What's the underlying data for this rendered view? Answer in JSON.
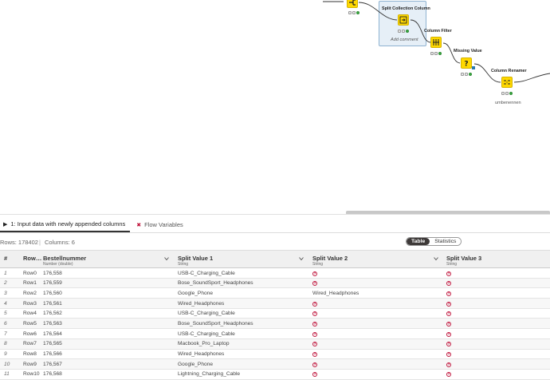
{
  "workflow": {
    "nodes": [
      {
        "id": "top-left-node",
        "title": "",
        "subtitle": ""
      },
      {
        "id": "split-collection-column",
        "title": "Split Collection Column",
        "subtitle": "Add comment"
      },
      {
        "id": "column-filter",
        "title": "Column Filter",
        "subtitle": ""
      },
      {
        "id": "missing-value",
        "title": "Missing Value",
        "subtitle": ""
      },
      {
        "id": "column-renamer",
        "title": "Column Renamer",
        "subtitle": "umbenennen"
      }
    ]
  },
  "tabs": [
    {
      "label": "1: Input data with newly appended columns",
      "icon": "play-icon"
    },
    {
      "label": "Flow Variables",
      "icon": "flow-variable-icon"
    }
  ],
  "info": {
    "rows": "Rows: 178402",
    "separator": "|",
    "columns": "Columns: 6"
  },
  "view_toggle": {
    "table": "Table",
    "statistics": "Statistics"
  },
  "table": {
    "headers": [
      {
        "title": "#",
        "type": ""
      },
      {
        "title": "Row…",
        "type": ""
      },
      {
        "title": "Bestellnummer",
        "type": "Number (double)"
      },
      {
        "title": "Split Value 1",
        "type": "String"
      },
      {
        "title": "Split Value 2",
        "type": "String"
      },
      {
        "title": "Split Value 3",
        "type": "String"
      }
    ],
    "missing_symbol": "?",
    "rows": [
      {
        "n": "1",
        "id": "Row0",
        "num": "176,558",
        "v1": "USB-C_Charging_Cable",
        "v2": null,
        "v3": null
      },
      {
        "n": "2",
        "id": "Row1",
        "num": "176,559",
        "v1": "Bose_SoundSport_Headphones",
        "v2": null,
        "v3": null
      },
      {
        "n": "3",
        "id": "Row2",
        "num": "176,560",
        "v1": "Google_Phone",
        "v2": "Wired_Headphones",
        "v3": null
      },
      {
        "n": "4",
        "id": "Row3",
        "num": "176,561",
        "v1": "Wired_Headphones",
        "v2": null,
        "v3": null
      },
      {
        "n": "5",
        "id": "Row4",
        "num": "176,562",
        "v1": "USB-C_Charging_Cable",
        "v2": null,
        "v3": null
      },
      {
        "n": "6",
        "id": "Row5",
        "num": "176,563",
        "v1": "Bose_SoundSport_Headphones",
        "v2": null,
        "v3": null
      },
      {
        "n": "7",
        "id": "Row6",
        "num": "176,564",
        "v1": "USB-C_Charging_Cable",
        "v2": null,
        "v3": null
      },
      {
        "n": "8",
        "id": "Row7",
        "num": "176,565",
        "v1": "Macbook_Pro_Laptop",
        "v2": null,
        "v3": null
      },
      {
        "n": "9",
        "id": "Row8",
        "num": "176,566",
        "v1": "Wired_Headphones",
        "v2": null,
        "v3": null
      },
      {
        "n": "10",
        "id": "Row9",
        "num": "176,567",
        "v1": "Google_Phone",
        "v2": null,
        "v3": null
      },
      {
        "n": "11",
        "id": "Row10",
        "num": "176,568",
        "v1": "Lightning_Charging_Cable",
        "v2": null,
        "v3": null
      }
    ]
  }
}
